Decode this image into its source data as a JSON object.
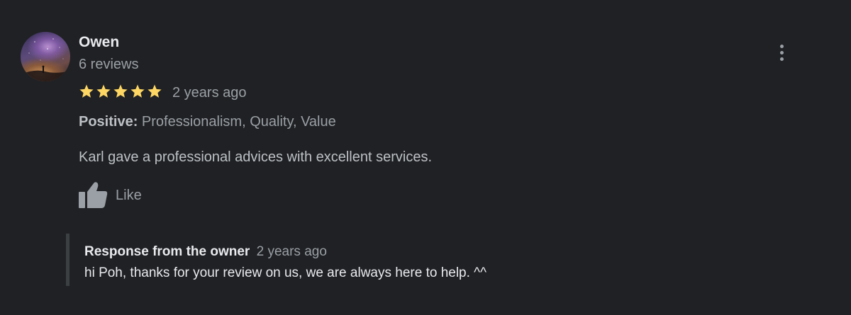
{
  "review": {
    "author": "Owen",
    "review_count": "6 reviews",
    "rating": 5,
    "rating_max": 5,
    "date": "2 years ago",
    "aspects_label": "Positive:",
    "aspects_value": "Professionalism, Quality, Value",
    "text": "Karl gave a professional advices with excellent services.",
    "like_label": "Like",
    "star_color": "#fdd663"
  },
  "owner_response": {
    "title": "Response from the owner",
    "date": "2 years ago",
    "text": "hi Poh, thanks for your review on us, we are always here to help. ^^"
  },
  "icons": {
    "menu": "more-vert-icon",
    "like": "thumb-up-icon",
    "star": "star-icon"
  }
}
